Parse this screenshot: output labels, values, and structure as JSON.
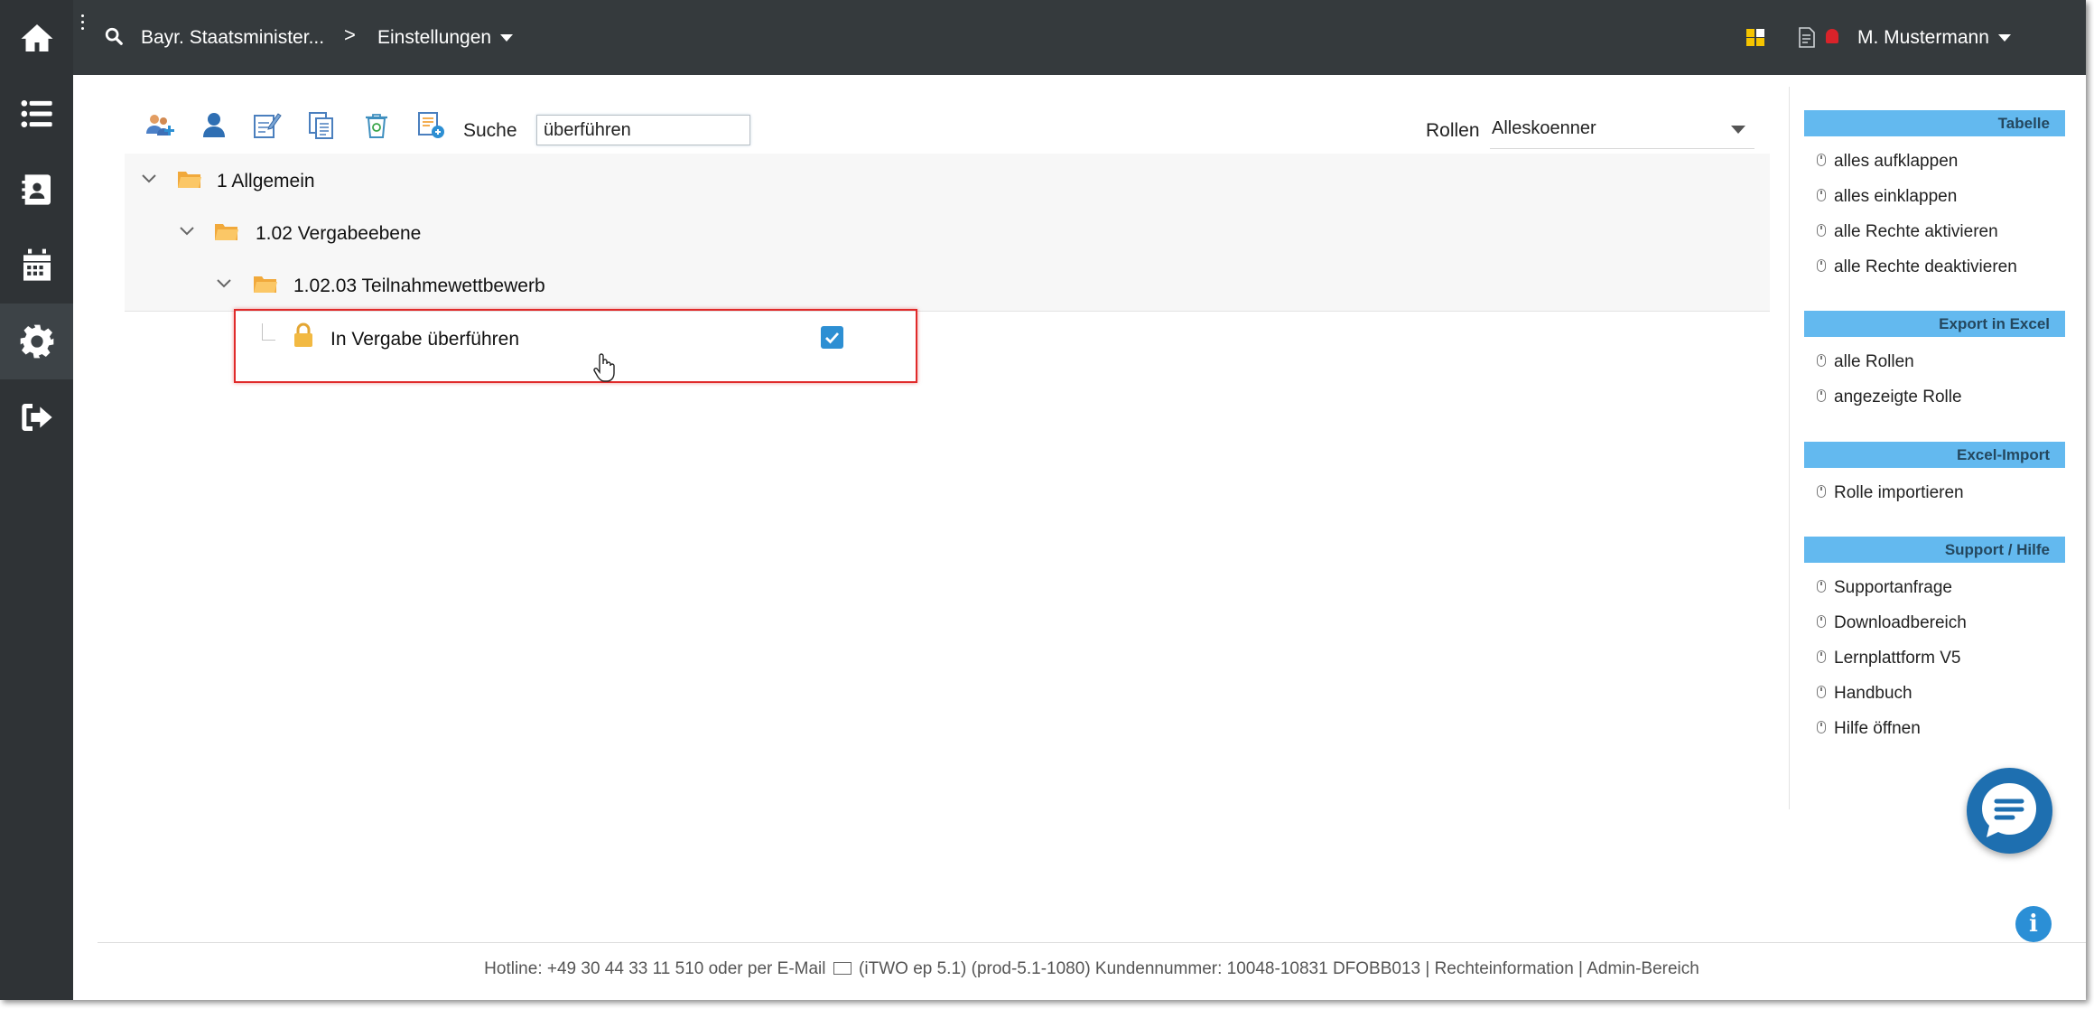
{
  "header": {
    "breadcrumb_1": "Bayr. Staatsminister...",
    "breadcrumb_sep": ">",
    "breadcrumb_2": "Einstellungen",
    "user_name": "M. Mustermann"
  },
  "sidebar": {
    "items": [
      "home-icon",
      "list-icon",
      "contacts-icon",
      "calendar-icon",
      "gear-icon",
      "logout-icon"
    ],
    "active": "gear-icon"
  },
  "toolbar": {
    "search_label": "Suche",
    "search_value": "überführen",
    "roles_label": "Rollen",
    "roles_value": "Alleskoenner"
  },
  "tree": {
    "level1": "1 Allgemein",
    "level2": "1.02 Vergabeebene",
    "level3": "1.02.03 Teilnahmewettbewerb",
    "leaf": "In Vergabe überführen",
    "leaf_checked": true
  },
  "right_panel": {
    "sections": [
      {
        "title": "Tabelle",
        "links": [
          "alles aufklappen",
          "alles einklappen",
          "alle Rechte aktivieren",
          "alle Rechte deaktivieren"
        ]
      },
      {
        "title": "Export in Excel",
        "links": [
          "alle Rollen",
          "angezeigte Rolle"
        ]
      },
      {
        "title": "Excel-Import",
        "links": [
          "Rolle importieren"
        ]
      },
      {
        "title": "Support / Hilfe",
        "links": [
          "Supportanfrage",
          "Downloadbereich",
          "Lernplattform V5",
          "Handbuch",
          "Hilfe öffnen"
        ]
      }
    ]
  },
  "footer": {
    "text_before_mail": "Hotline: +49 30 44 33 11 510 oder per E-Mail",
    "text_after_mail": "(iTWO ep 5.1) (prod-5.1-1080)   Kundennummer: 10048-10831 DFOBB013 | Rechteinformation  |  Admin-Bereich"
  },
  "colors": {
    "sidebar": "#2f3336",
    "header": "#353a3d",
    "accent": "#63b9ef",
    "highlight": "#e02a2a",
    "checkbox": "#2d8fd3"
  }
}
